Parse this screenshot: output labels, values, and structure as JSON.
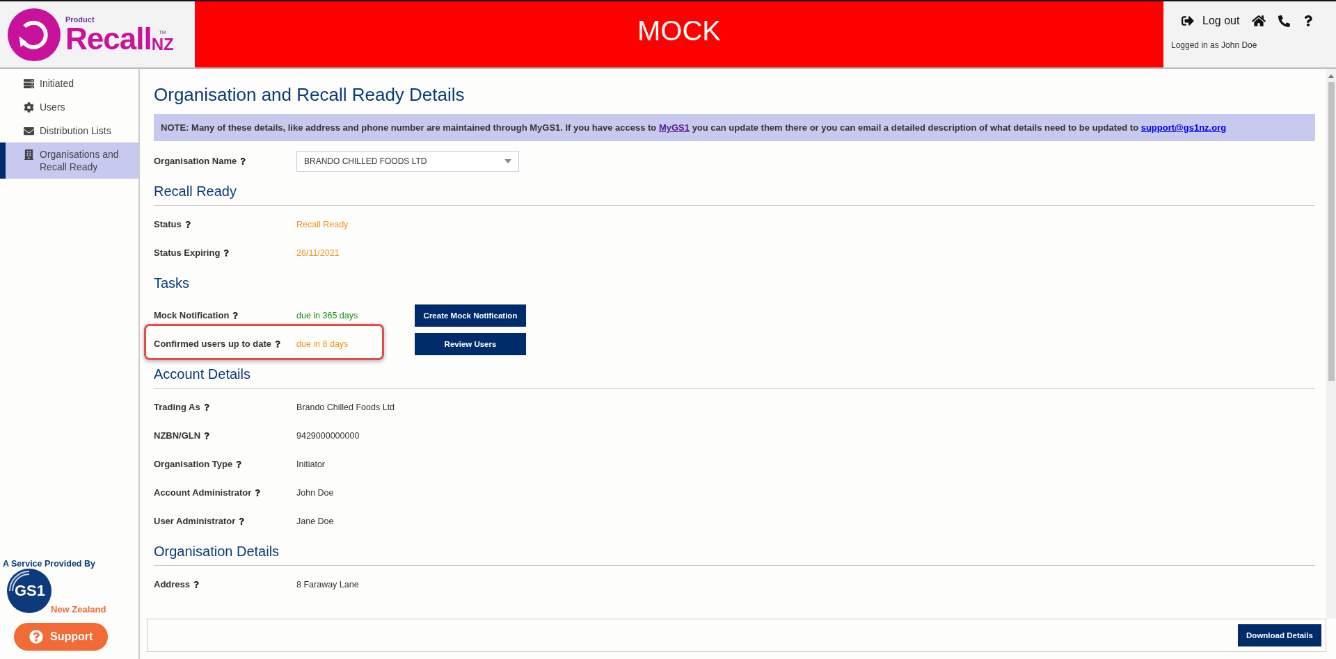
{
  "header": {
    "logo": {
      "small": "Product",
      "main": "Recall",
      "suffix": "NZ",
      "tm": "TM"
    },
    "banner": "MOCK",
    "logout": "Log out",
    "logged_in": "Logged in as John Doe"
  },
  "sidebar": {
    "items": [
      {
        "label": "Initiated",
        "selected": false
      },
      {
        "label": "Users",
        "selected": false
      },
      {
        "label": "Distribution Lists",
        "selected": false
      },
      {
        "label": "Organisations and Recall Ready",
        "selected": true
      }
    ],
    "provider": "A Service Provided By",
    "provider_logo": {
      "mark": "GS1",
      "region": "New Zealand"
    },
    "support": "Support"
  },
  "page": {
    "title": "Organisation and Recall Ready Details",
    "note": "**NOTE: Many of these details, like address and phone number are maintained through MyGS1. If you have access to**",
    "note_link": "MyGS1",
    "note_mid": "**you can update them there or you can email a detailed description of what details need to be updated to**",
    "note_email": "support@gs1nz.org",
    "org_label": "Organisation Name",
    "org_value": "BRANDO CHILLED FOODS LTD",
    "sections": [
      {
        "title": "Recall Ready",
        "rule": true,
        "rows": [
          {
            "label": "Status",
            "value": "Recall Ready",
            "color": "#f7941d"
          },
          {
            "label": "Status Expiring",
            "value": "26/11/2021",
            "color": "#f7941d"
          }
        ]
      },
      {
        "title": "Tasks",
        "rule": false,
        "rows": [
          {
            "label": "Mock Notification",
            "value": "due in 365 days",
            "color": "#1a8a1a",
            "button": "Create Mock Notification",
            "highlighted": false
          },
          {
            "label": "Confirmed users up to date",
            "value": "due in 8 days",
            "color": "#f7941d",
            "button": "Review Users",
            "highlighted": true
          }
        ]
      },
      {
        "title": "Account Details",
        "rule": true,
        "rows": [
          {
            "label": "Trading As",
            "value": "Brando Chilled Foods Ltd"
          },
          {
            "label": "NZBN/GLN",
            "value": "9429000000000"
          },
          {
            "label": "Organisation Type",
            "value": "Initiator"
          },
          {
            "label": "Account Administrator",
            "value": "John Doe"
          },
          {
            "label": "User Administrator",
            "value": "Jane Doe"
          }
        ]
      },
      {
        "title": "Organisation Details",
        "rule": true,
        "rows": [
          {
            "label": "Address",
            "value": "8 Faraway Lane"
          }
        ]
      }
    ]
  },
  "footer": {
    "button": "Download Details"
  }
}
